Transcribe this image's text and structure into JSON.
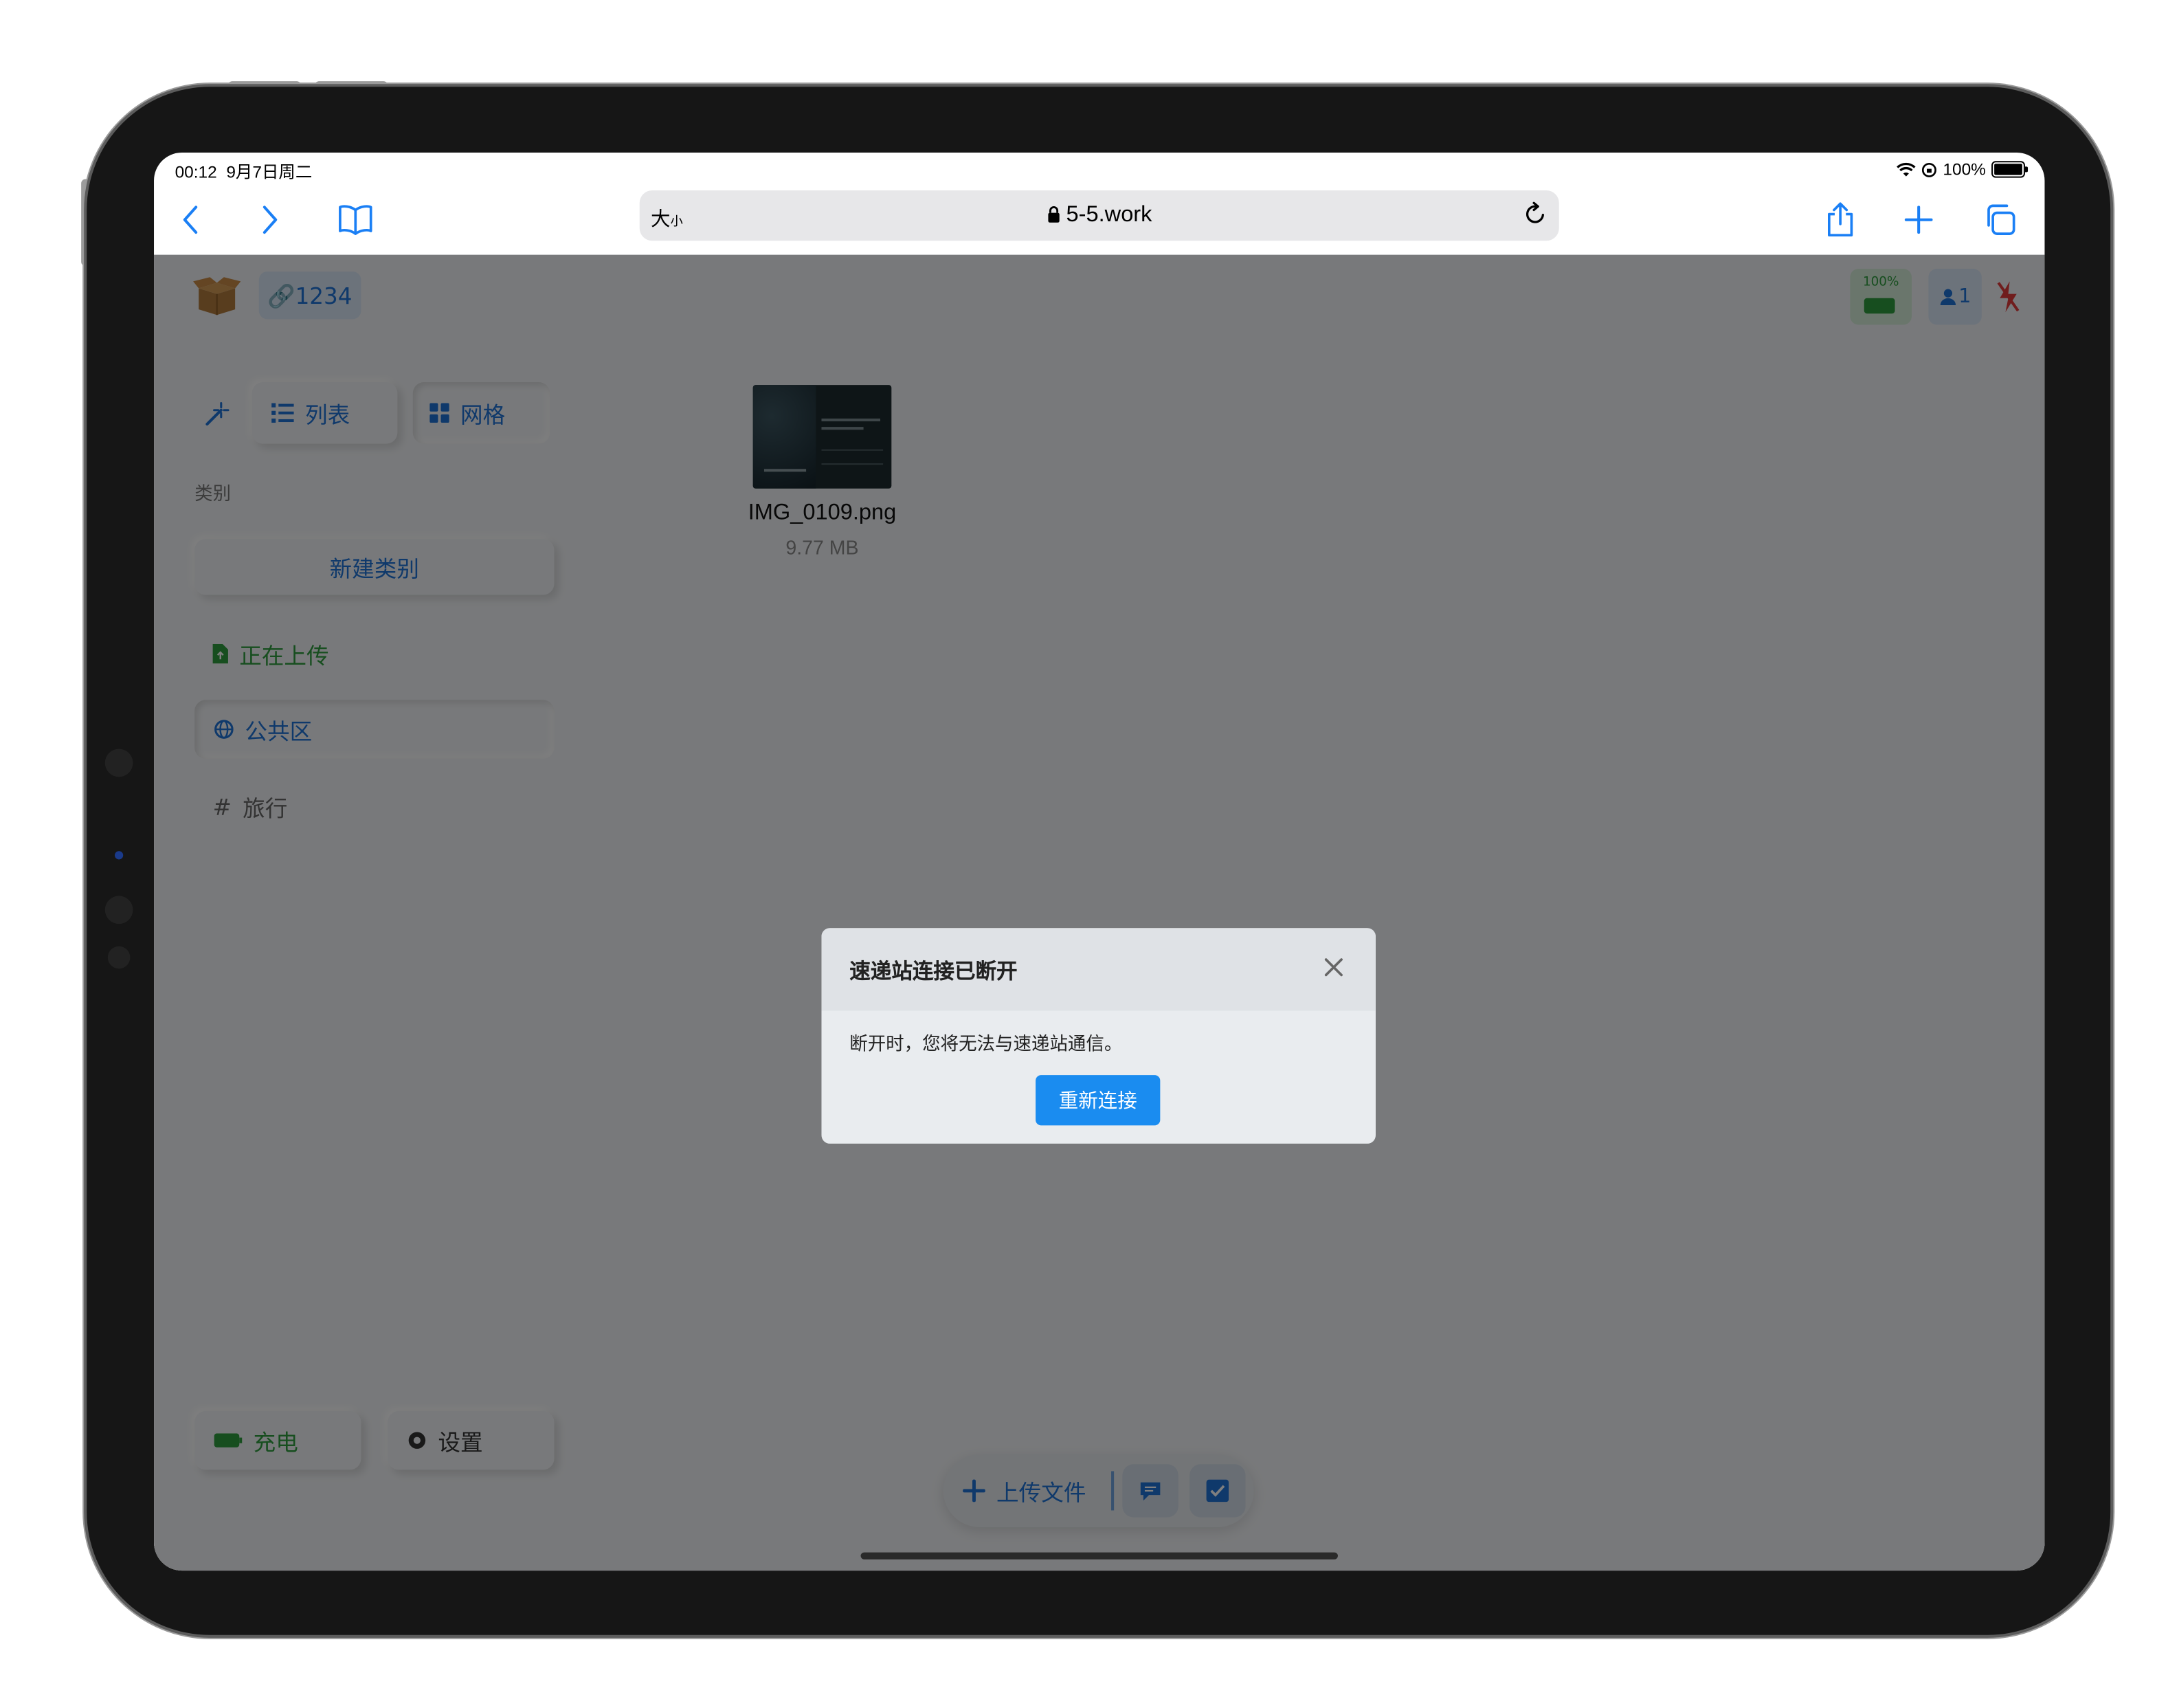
{
  "status_bar": {
    "time": "00:12",
    "date": "9月7日周二",
    "battery": "100%"
  },
  "browser": {
    "text_size_label": "大",
    "text_size_small": "小",
    "url": "5-5.work",
    "icons": [
      "back-icon",
      "forward-icon",
      "bookmarks-icon",
      "lock-icon",
      "reload-icon",
      "share-icon",
      "new-tab-icon",
      "tabs-icon"
    ]
  },
  "header": {
    "room_code": "🔗1234",
    "battery_percent": "100%",
    "user_count": "1"
  },
  "sidebar": {
    "view_list": "列表",
    "view_grid": "网格",
    "category_heading": "类别",
    "new_category": "新建类别",
    "uploading": "正在上传",
    "public_area": "公共区",
    "tag_symbol": "#",
    "tag_travel": "旅行",
    "charge": "充电",
    "settings": "设置"
  },
  "files": [
    {
      "name": "IMG_0109.png",
      "size": "9.77 MB"
    }
  ],
  "bottom_bar": {
    "upload_label": "上传文件"
  },
  "modal": {
    "title": "速递站连接已断开",
    "message": "断开时，您将无法与速递站通信。",
    "reconnect": "重新连接"
  },
  "colors": {
    "accent": "#1e72d6",
    "success": "#2f9c3f",
    "danger": "#e03a3a",
    "primary_button": "#1a8cf0"
  }
}
